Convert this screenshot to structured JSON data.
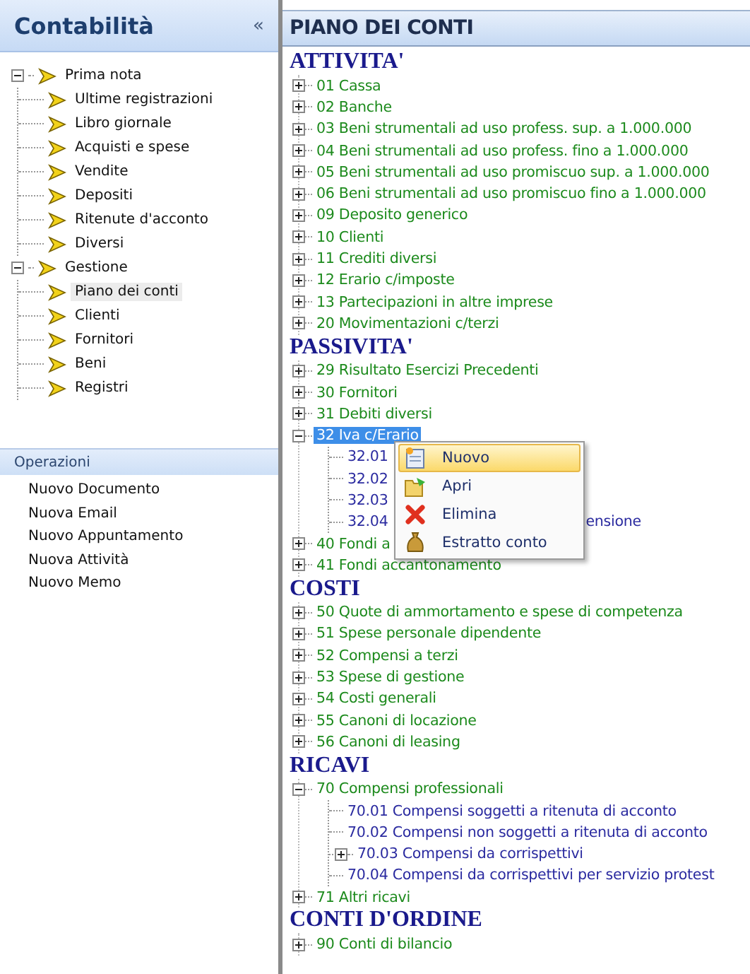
{
  "sidebar": {
    "title": "Contabilità",
    "collapse_glyph": "«",
    "tree": [
      {
        "label": "Prima nota",
        "expanded": true,
        "children": [
          {
            "label": "Ultime registrazioni",
            "selected": false
          },
          {
            "label": "Libro giornale",
            "selected": false
          },
          {
            "label": "Acquisti e spese",
            "selected": false
          },
          {
            "label": "Vendite",
            "selected": false
          },
          {
            "label": "Depositi",
            "selected": false
          },
          {
            "label": "Ritenute d'acconto",
            "selected": false
          },
          {
            "label": "Diversi",
            "selected": false
          }
        ]
      },
      {
        "label": "Gestione",
        "expanded": true,
        "children": [
          {
            "label": "Piano dei conti",
            "selected": true
          },
          {
            "label": "Clienti",
            "selected": false
          },
          {
            "label": "Fornitori",
            "selected": false
          },
          {
            "label": "Beni",
            "selected": false
          },
          {
            "label": "Registri",
            "selected": false
          }
        ]
      }
    ]
  },
  "operations": {
    "title": "Operazioni",
    "items": [
      "Nuovo Documento",
      "Nuova Email",
      "Nuovo Appuntamento",
      "Nuova Attività",
      "Nuovo Memo"
    ]
  },
  "main": {
    "title": "PIANO DEI CONTI",
    "sections": [
      {
        "title": "ATTIVITA'",
        "accounts": [
          {
            "label": "01 Cassa",
            "expanded": false,
            "selected": false
          },
          {
            "label": "02 Banche",
            "expanded": false,
            "selected": false
          },
          {
            "label": "03 Beni strumentali ad uso profess. sup. a 1.000.000",
            "expanded": false,
            "selected": false
          },
          {
            "label": "04 Beni strumentali ad uso profess. fino a 1.000.000",
            "expanded": false,
            "selected": false
          },
          {
            "label": "05 Beni strumentali ad uso promiscuo sup. a 1.000.000",
            "expanded": false,
            "selected": false
          },
          {
            "label": "06 Beni strumentali ad uso promiscuo fino a 1.000.000",
            "expanded": false,
            "selected": false
          },
          {
            "label": "09 Deposito generico",
            "expanded": false,
            "selected": false
          },
          {
            "label": "10 Clienti",
            "expanded": false,
            "selected": false
          },
          {
            "label": "11 Crediti diversi",
            "expanded": false,
            "selected": false
          },
          {
            "label": "12 Erario c/imposte",
            "expanded": false,
            "selected": false
          },
          {
            "label": "13 Partecipazioni in altre imprese",
            "expanded": false,
            "selected": false
          },
          {
            "label": "20 Movimentazioni c/terzi",
            "expanded": false,
            "selected": false
          }
        ]
      },
      {
        "title": "PASSIVITA'",
        "accounts": [
          {
            "label": "29 Risultato Esercizi Precedenti",
            "expanded": false,
            "selected": false
          },
          {
            "label": "30 Fornitori",
            "expanded": false,
            "selected": false
          },
          {
            "label": "31 Debiti diversi",
            "expanded": false,
            "selected": false
          },
          {
            "label": "32 Iva c/Erario",
            "expanded": true,
            "selected": true,
            "children": [
              {
                "label": "32.01"
              },
              {
                "label": "32.02"
              },
              {
                "label": "32.03"
              },
              {
                "label": "32.04",
                "trailing": "ensione"
              }
            ]
          },
          {
            "label": "40 Fondi a",
            "expanded": false,
            "selected": false
          },
          {
            "label": "41 Fondi accantonamento",
            "expanded": false,
            "selected": false
          }
        ]
      },
      {
        "title": "COSTI",
        "accounts": [
          {
            "label": "50 Quote di ammortamento e spese di competenza",
            "expanded": false,
            "selected": false
          },
          {
            "label": "51 Spese personale dipendente",
            "expanded": false,
            "selected": false
          },
          {
            "label": "52 Compensi a terzi",
            "expanded": false,
            "selected": false
          },
          {
            "label": "53 Spese di gestione",
            "expanded": false,
            "selected": false
          },
          {
            "label": "54 Costi generali",
            "expanded": false,
            "selected": false
          },
          {
            "label": "55 Canoni di locazione",
            "expanded": false,
            "selected": false
          },
          {
            "label": "56 Canoni di leasing",
            "expanded": false,
            "selected": false
          }
        ]
      },
      {
        "title": "RICAVI",
        "accounts": [
          {
            "label": "70 Compensi professionali",
            "expanded": true,
            "selected": false,
            "children": [
              {
                "label": "70.01 Compensi soggetti a ritenuta di acconto"
              },
              {
                "label": "70.02 Compensi non soggetti a ritenuta di acconto"
              },
              {
                "label": "70.03 Compensi da corrispettivi",
                "expanded": false
              },
              {
                "label": "70.04 Compensi da corrispettivi per servizio protest"
              }
            ]
          },
          {
            "label": "71 Altri ricavi",
            "expanded": false,
            "selected": false
          }
        ]
      },
      {
        "title": "CONTI D'ORDINE",
        "accounts": [
          {
            "label": "90 Conti di bilancio",
            "expanded": false,
            "selected": false
          }
        ]
      }
    ]
  },
  "context_menu": {
    "items": [
      {
        "label": "Nuovo",
        "kind": "new",
        "selected": true
      },
      {
        "label": "Apri",
        "kind": "open",
        "selected": false
      },
      {
        "label": "Elimina",
        "kind": "delete",
        "selected": false
      },
      {
        "label": "Estratto conto",
        "kind": "money",
        "selected": false
      }
    ]
  }
}
